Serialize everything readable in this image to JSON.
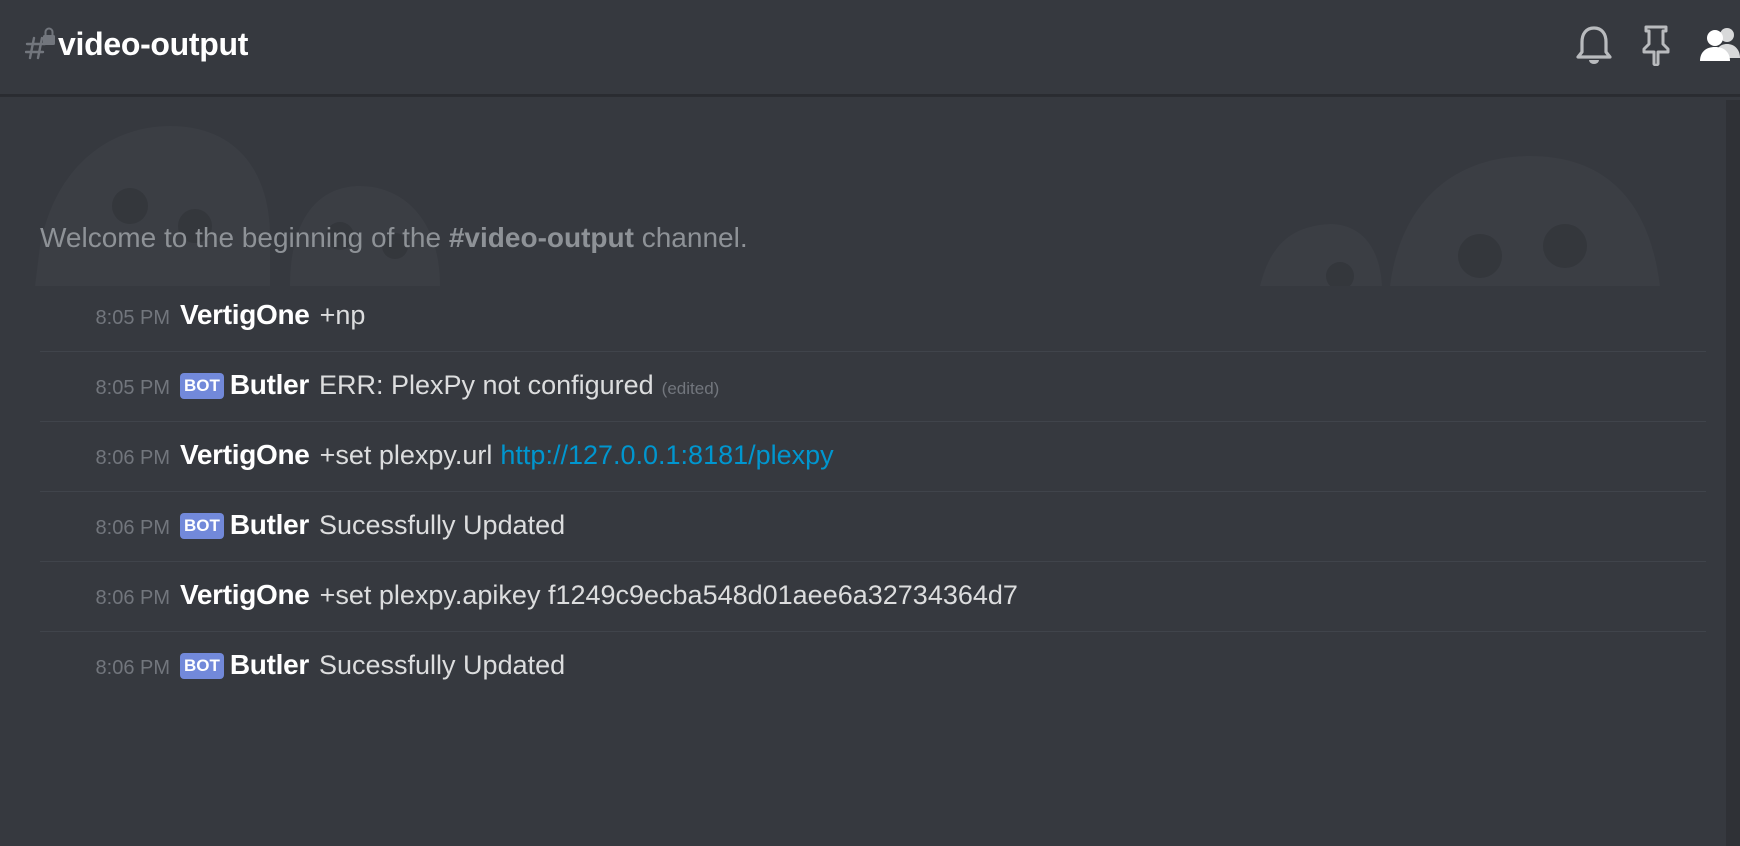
{
  "header": {
    "channel_name": "video-output"
  },
  "welcome": {
    "prefix": "Welcome to the beginning of the ",
    "channel": "#video-output",
    "suffix": " channel."
  },
  "messages": [
    {
      "time": "8:05 PM",
      "author": "VertigOne",
      "content": "+np"
    },
    {
      "time": "8:05 PM",
      "bot_tag": "BOT",
      "author": "Butler",
      "content": "ERR: PlexPy not configured",
      "edited": "(edited)"
    },
    {
      "time": "8:06 PM",
      "author": "VertigOne",
      "content": "+set plexpy.url",
      "link": "http://127.0.0.1:8181/plexpy"
    },
    {
      "time": "8:06 PM",
      "bot_tag": "BOT",
      "author": "Butler",
      "content": "Sucessfully Updated"
    },
    {
      "time": "8:06 PM",
      "author": "VertigOne",
      "content": "+set plexpy.apikey f1249c9ecba548d01aee6a32734364d7"
    },
    {
      "time": "8:06 PM",
      "bot_tag": "BOT",
      "author": "Butler",
      "content": "Sucessfully Updated"
    }
  ],
  "icons": {
    "header": [
      "locked-channel-icon",
      "bell-icon",
      "pin-icon",
      "members-icon"
    ]
  },
  "colors": {
    "background": "#36393f",
    "bot_tag": "#7289da",
    "link": "#0096cf",
    "timestamp": "#72767d",
    "message_text": "#dcddde"
  }
}
